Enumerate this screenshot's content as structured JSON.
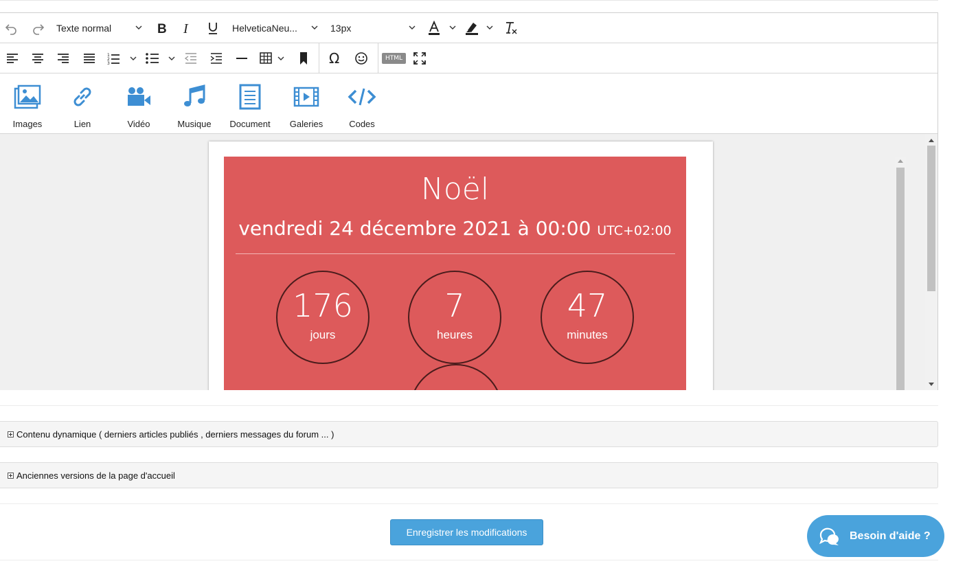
{
  "toolbar": {
    "block_format": "Texte normal",
    "font_family": "HelveticaNeu...",
    "font_size": "13px",
    "html_label": "HTML"
  },
  "media_buttons": [
    {
      "label": "Images",
      "icon": "image-icon"
    },
    {
      "label": "Lien",
      "icon": "link-icon"
    },
    {
      "label": "Vidéo",
      "icon": "video-camera-icon"
    },
    {
      "label": "Musique",
      "icon": "music-note-icon"
    },
    {
      "label": "Document",
      "icon": "document-icon"
    },
    {
      "label": "Galeries",
      "icon": "film-gallery-icon"
    },
    {
      "label": "Codes",
      "icon": "code-icon"
    }
  ],
  "countdown": {
    "event": "Noël",
    "date": "vendredi 24 décembre 2021 à 00:00",
    "timezone": "UTC+02:00",
    "units": [
      {
        "value": "176",
        "label": "jours"
      },
      {
        "value": "7",
        "label": "heures"
      },
      {
        "value": "47",
        "label": "minutes"
      }
    ],
    "background": "#dd5a5b"
  },
  "panels": {
    "dynamic_content": "Contenu dynamique ( derniers articles publiés , derniers messages du forum ... )",
    "old_versions": "Anciennes versions de la page d'accueil"
  },
  "save_label": "Enregistrer les modifications",
  "help_label": "Besoin d'aide ?",
  "colors": {
    "accent": "#4aa3dc",
    "icon_blue": "#3d8ed3"
  }
}
